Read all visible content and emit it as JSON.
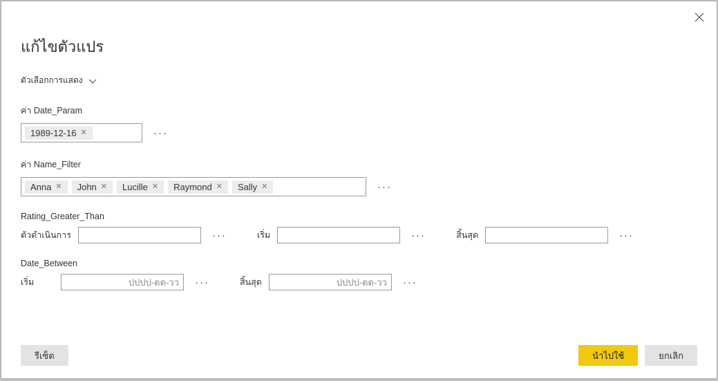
{
  "dialog": {
    "title": "แก้ไขตัวแปร",
    "display_options_label": "ตัวเลือกการแสดง"
  },
  "params": {
    "date_param": {
      "label": "ค่า Date_Param",
      "value": "1989-12-16"
    },
    "name_filter": {
      "label": "ค่า Name_Filter",
      "values": [
        "Anna",
        "John",
        "Lucille",
        "Raymond",
        "Sally"
      ]
    },
    "rating": {
      "label": "Rating_Greater_Than",
      "operator_label": "ตัวดำเนินการ",
      "start_label": "เริ่ม",
      "end_label": "สิ้นสุด"
    },
    "date_between": {
      "label": "Date_Between",
      "start_label": "เริ่ม",
      "end_label": "สิ้นสุด",
      "placeholder": "ปปปป-ดด-วว"
    }
  },
  "buttons": {
    "reset": "รีเซ็ต",
    "apply": "นำไปใช้",
    "cancel": "ยกเลิก"
  }
}
